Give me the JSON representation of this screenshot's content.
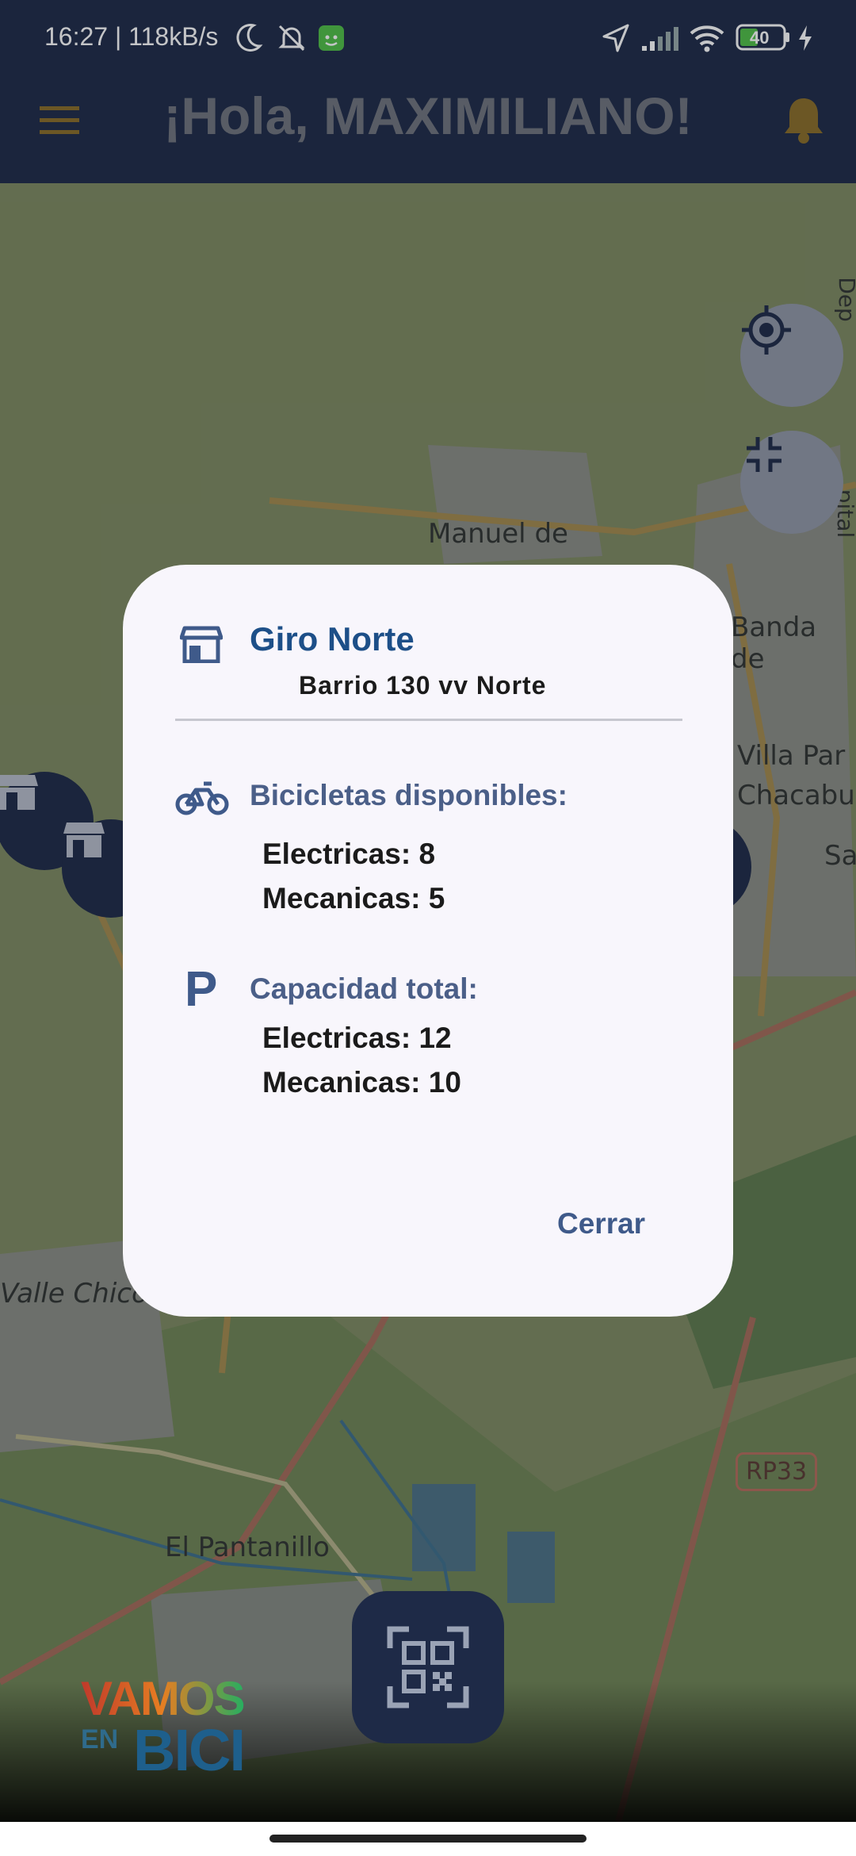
{
  "status_bar": {
    "time_speed": "16:27 | 118kB/s",
    "battery": "40",
    "icons": [
      "moon-icon",
      "bell-off-icon",
      "app-notification-icon",
      "location-arrow-icon",
      "signal-icon",
      "wifi-icon",
      "battery-icon",
      "charging-icon"
    ]
  },
  "header": {
    "greeting": "¡Hola, MAXIMILIANO!",
    "menu_icon": "hamburger-menu-icon",
    "bell_icon": "bell-icon",
    "accent": "#b08a2a"
  },
  "map": {
    "labels": [
      "Manuel de",
      "Banda de",
      "Villa Par",
      "Chacabu",
      "Sa",
      "Valle Chico",
      "El Pantanillo",
      "RP33",
      "Dep",
      "pital"
    ]
  },
  "dialog": {
    "station_name": "Giro Norte",
    "address": "Barrio 130 vv Norte",
    "available_title": "Bicicletas disponibles:",
    "available": [
      {
        "label": "Electricas: 8"
      },
      {
        "label": "Mecanicas: 5"
      }
    ],
    "capacity_title": "Capacidad total:",
    "capacity_icon_letter": "P",
    "capacity": [
      {
        "label": "Electricas: 12"
      },
      {
        "label": "Mecanicas: 10"
      }
    ],
    "close_label": "Cerrar"
  },
  "logo": {
    "line1": "VAMOS",
    "line2": "EN",
    "line3": "BICI"
  },
  "colors": {
    "header_bg": "#1e2a47",
    "dialog_bg": "#f8f6fc",
    "title_blue": "#1d4f88",
    "section_blue": "#4b5f88"
  }
}
